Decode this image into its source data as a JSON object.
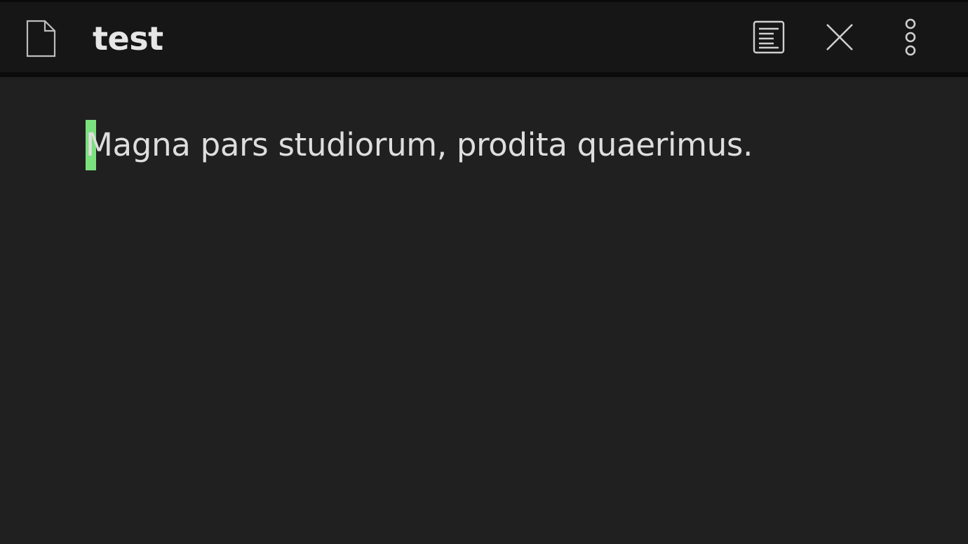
{
  "header": {
    "title": "test",
    "file_icon": "file-icon",
    "outline_icon": "document-outline-icon",
    "close_icon": "close-icon",
    "menu_icon": "more-vertical-icon"
  },
  "editor": {
    "text": "Magna pars studiorum, prodita quaerimus.",
    "cursor_color": "#7be07e"
  },
  "colors": {
    "background": "#202020",
    "header_background": "#161616",
    "text": "#dedede"
  }
}
